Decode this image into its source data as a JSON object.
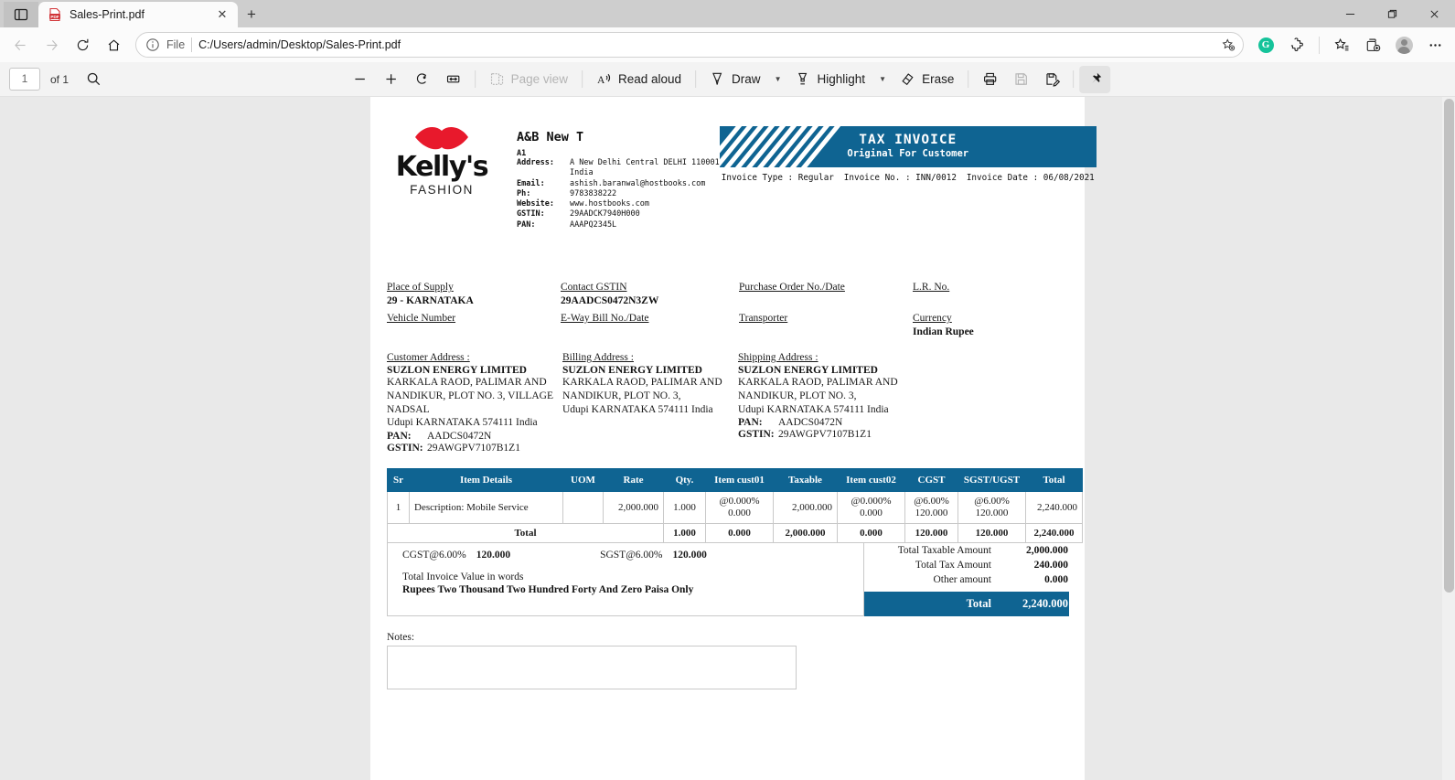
{
  "browser": {
    "tab": {
      "title": "Sales-Print.pdf",
      "favicon": "pdf-icon",
      "close": "✕"
    },
    "newtab_label": "+",
    "omnibox": {
      "file_label": "File",
      "url": "C:/Users/admin/Desktop/Sales-Print.pdf"
    },
    "window": {
      "minimize": "minimize-icon",
      "maximize": "maximize-icon",
      "close": "close-icon"
    }
  },
  "pdfbar": {
    "page_current": "1",
    "page_count": "of 1",
    "search": "search-icon",
    "zoom_out": "−",
    "zoom_in": "+",
    "rotate": "rotate-icon",
    "fit": "fit-page-icon",
    "page_view": "Page view",
    "read_aloud": "Read aloud",
    "draw": "Draw",
    "highlight": "Highlight",
    "erase": "Erase",
    "print": "print-icon",
    "save": "save-icon",
    "save_as": "save-as-icon",
    "pin": "pin-icon"
  },
  "invoice": {
    "logo": {
      "name": "Kelly's",
      "sub": "FASHION"
    },
    "company": {
      "name": "A&B New T",
      "a1": "A1",
      "rows": [
        {
          "label": "Address:",
          "value": "A New Delhi Central DELHI 110001"
        },
        {
          "label": "",
          "value": "India"
        },
        {
          "label": "Email:",
          "value": "ashish.baranwal@hostbooks.com"
        },
        {
          "label": "Ph:",
          "value": "9783838222"
        },
        {
          "label": "Website:",
          "value": "www.hostbooks.com"
        },
        {
          "label": "GSTIN:",
          "value": "29AADCK7940H000"
        },
        {
          "label": "PAN:",
          "value": "AAAPQ2345L"
        }
      ]
    },
    "banner": {
      "title": "TAX INVOICE",
      "subtitle": "Original For Customer",
      "meta": [
        "Invoice Type : Regular",
        "Invoice No. : INN/0012",
        "Invoice Date : 06/08/2021"
      ]
    },
    "fields": [
      {
        "label": "Place of Supply",
        "value": "29 - KARNATAKA"
      },
      {
        "label": "Contact GSTIN",
        "value": "29AADCS0472N3ZW"
      },
      {
        "label": "Purchase Order No./Date",
        "value": ""
      },
      {
        "label": "L.R. No.",
        "value": ""
      },
      {
        "label": "Vehicle Number",
        "value": ""
      },
      {
        "label": "E-Way Bill No./Date",
        "value": ""
      },
      {
        "label": "Transporter",
        "value": ""
      },
      {
        "label": "Currency",
        "value": "Indian Rupee"
      }
    ],
    "addresses": [
      {
        "label": "Customer Address :",
        "name": "SUZLON ENERGY LIMITED",
        "lines": [
          "KARKALA RAOD, PALIMAR AND",
          "NANDIKUR, PLOT NO. 3, VILLAGE",
          "NADSAL",
          "Udupi KARNATAKA 574111 India"
        ],
        "pan_label": "PAN:",
        "pan": "AADCS0472N",
        "gstin_label": "GSTIN:",
        "gstin": "29AWGPV7107B1Z1"
      },
      {
        "label": "Billing Address :",
        "name": "SUZLON ENERGY LIMITED",
        "lines": [
          "KARKALA RAOD, PALIMAR AND",
          "NANDIKUR, PLOT NO. 3,",
          "Udupi KARNATAKA 574111 India"
        ],
        "pan_label": "",
        "pan": "",
        "gstin_label": "",
        "gstin": ""
      },
      {
        "label": "Shipping Address :",
        "name": "SUZLON ENERGY LIMITED",
        "lines": [
          "KARKALA RAOD, PALIMAR AND",
          "NANDIKUR, PLOT NO. 3,",
          "Udupi KARNATAKA 574111 India"
        ],
        "pan_label": "PAN:",
        "pan": "AADCS0472N",
        "gstin_label": "GSTIN:",
        "gstin": "29AWGPV7107B1Z1"
      }
    ],
    "table": {
      "headers": [
        "Sr",
        "Item Details",
        "UOM",
        "Rate",
        "Qty.",
        "Item cust01",
        "Taxable",
        "Item cust02",
        "CGST",
        "SGST/UGST",
        "Total"
      ],
      "rows": [
        {
          "sr": "1",
          "item": "Description: Mobile Service",
          "uom": "",
          "rate": "2,000.000",
          "qty": "1.000",
          "cust01_rate": "@0.000%",
          "cust01_amt": "0.000",
          "taxable": "2,000.000",
          "cust02_rate": "@0.000%",
          "cust02_amt": "0.000",
          "cgst_rate": "@6.00%",
          "cgst_amt": "120.000",
          "sgst_rate": "@6.00%",
          "sgst_amt": "120.000",
          "total": "2,240.000"
        }
      ],
      "total_row": {
        "label": "Total",
        "qty": "1.000",
        "cust01": "0.000",
        "taxable": "2,000.000",
        "cust02": "0.000",
        "cgst": "120.000",
        "sgst": "120.000",
        "total": "2,240.000"
      }
    },
    "tax_summary": {
      "cgst_label": "CGST@6.00%",
      "cgst_value": "120.000",
      "sgst_label": "SGST@6.00%",
      "sgst_value": "120.000",
      "words_label": "Total Invoice Value in words",
      "words_value": "Rupees Two Thousand Two Hundred Forty And Zero Paisa Only"
    },
    "totals": [
      {
        "label": "Total Taxable Amount",
        "value": "2,000.000"
      },
      {
        "label": "Total Tax Amount",
        "value": "240.000"
      },
      {
        "label": "Other amount",
        "value": "0.000"
      }
    ],
    "grand_total": {
      "label": "Total",
      "value": "2,240.000"
    },
    "notes_label": "Notes:"
  },
  "colors": {
    "accent": "#0f6492",
    "logo_red": "#e8192c"
  }
}
